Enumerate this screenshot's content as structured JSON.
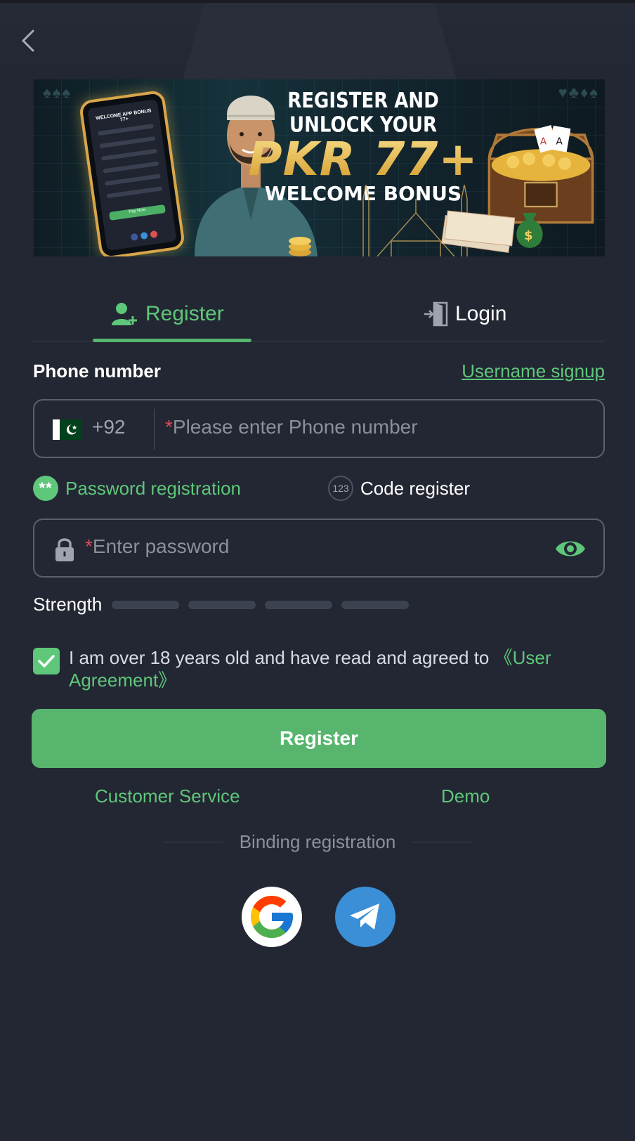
{
  "banner": {
    "line1": "REGISTER AND UNLOCK YOUR",
    "line2": "PKR 77+",
    "line3": "WELCOME BONUS",
    "phone_header": "WELCOME APP BONUS 77+",
    "phone_btn": "Pay Now"
  },
  "tabs": {
    "register": "Register",
    "login": "Login"
  },
  "form": {
    "phone_label": "Phone number",
    "username_signup": "Username signup",
    "country_code": "+92",
    "phone_placeholder": "Please enter Phone number",
    "mode_password": "Password registration",
    "mode_code": "Code register",
    "code_icon": "123",
    "password_placeholder": "Enter password",
    "strength_label": "Strength",
    "agree_text": "I am over 18 years old and have read and agreed to ",
    "agree_link": "《User Agreement》",
    "agree_checked": true,
    "register_button": "Register"
  },
  "footer": {
    "customer_service": "Customer Service",
    "demo": "Demo",
    "binding_registration": "Binding registration"
  },
  "colors": {
    "accent": "#57b56e",
    "background": "#232733",
    "telegram": "#3a8fd6"
  }
}
